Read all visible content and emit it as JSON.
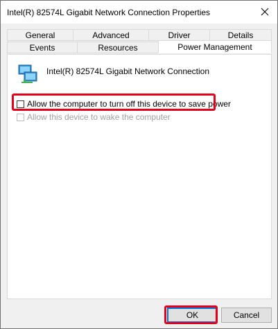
{
  "window": {
    "title": "Intel(R) 82574L Gigabit Network Connection Properties",
    "close_glyph": "✕"
  },
  "tabs": {
    "row_back": [
      "General",
      "Advanced",
      "Driver",
      "Details"
    ],
    "row_front": [
      "Events",
      "Resources",
      "Power Management"
    ],
    "active": "Power Management"
  },
  "device": {
    "icon": "network-adapter-icon",
    "name": "Intel(R) 82574L Gigabit Network Connection"
  },
  "options": [
    {
      "label": "Allow the computer to turn off this device to save power",
      "checked": false,
      "enabled": true,
      "highlighted": true
    },
    {
      "label": "Allow this device to wake the computer",
      "checked": false,
      "enabled": false,
      "highlighted": false
    }
  ],
  "buttons": {
    "ok": "OK",
    "cancel": "Cancel"
  },
  "colors": {
    "highlight": "#e4001b",
    "accent": "#0078d7"
  }
}
